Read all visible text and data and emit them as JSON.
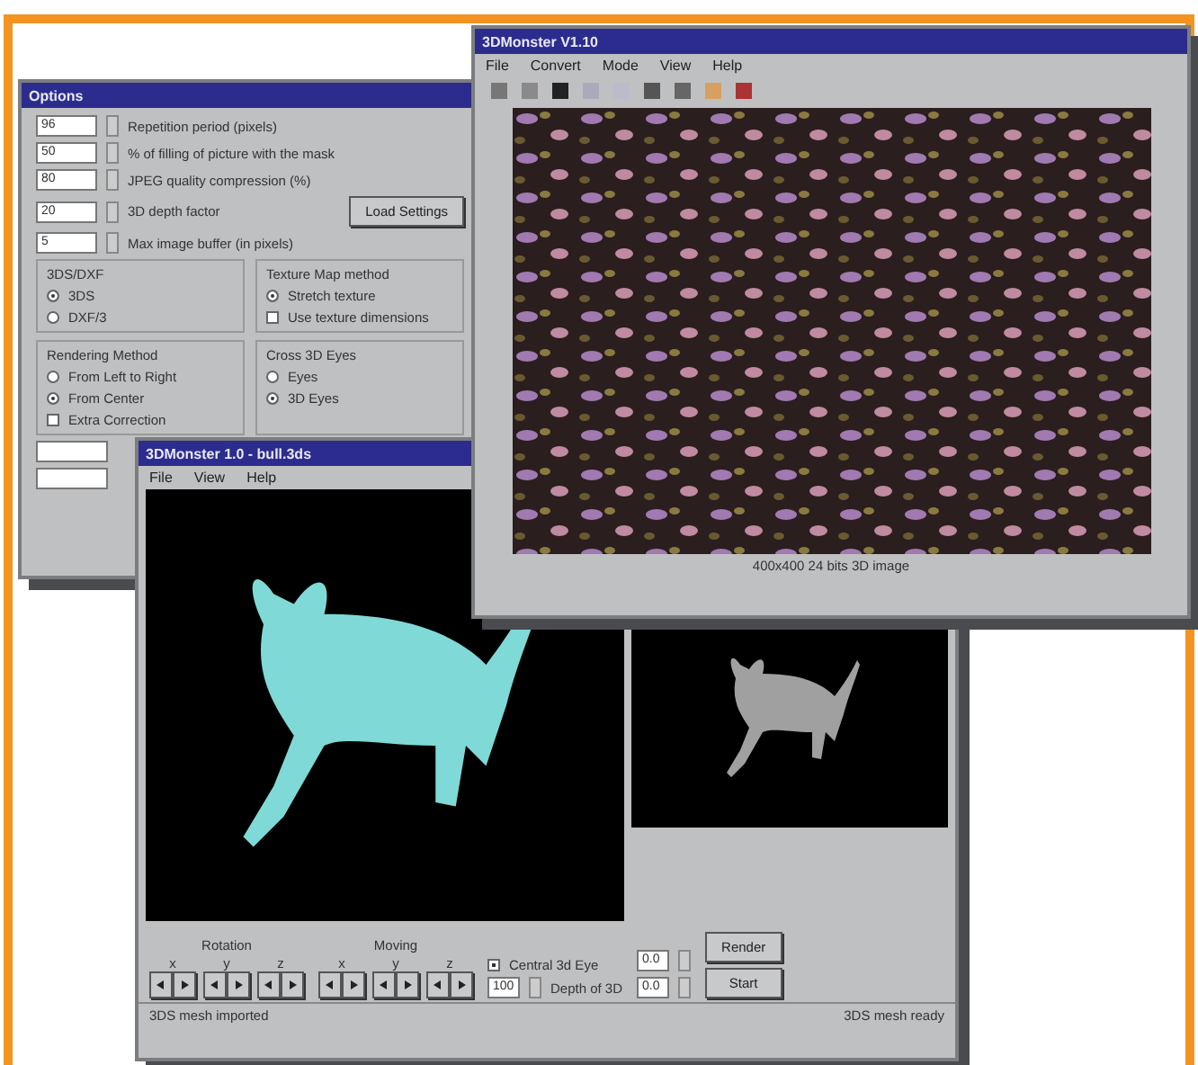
{
  "options_window": {
    "title": "Options",
    "spinners": [
      {
        "value": "96",
        "label": "Repetition period (pixels)"
      },
      {
        "value": "50",
        "label": "% of filling of picture with the mask"
      },
      {
        "value": "80",
        "label": "JPEG quality compression (%)"
      },
      {
        "value": "20",
        "label": "3D depth factor"
      },
      {
        "value": "5",
        "label": "Max image buffer (in pixels)"
      }
    ],
    "load_button": "Load Settings",
    "groups": [
      {
        "title": "3DS/DXF",
        "items": [
          {
            "kind": "radio",
            "label": "3DS",
            "selected": true
          },
          {
            "kind": "radio",
            "label": "DXF/3",
            "selected": false
          }
        ]
      },
      {
        "title": "Texture Map method",
        "items": [
          {
            "kind": "radio",
            "label": "Stretch texture",
            "selected": true
          },
          {
            "kind": "check",
            "label": "Use texture dimensions",
            "selected": false
          }
        ]
      },
      {
        "title": "Rendering Method",
        "items": [
          {
            "kind": "radio",
            "label": "From Left to Right",
            "selected": false
          },
          {
            "kind": "radio",
            "label": "From Center",
            "selected": true
          },
          {
            "kind": "check",
            "label": "Extra Correction",
            "selected": false
          }
        ]
      },
      {
        "title": "Cross 3D Eyes",
        "items": [
          {
            "kind": "radio",
            "label": "Eyes",
            "selected": false
          },
          {
            "kind": "radio",
            "label": "3D Eyes",
            "selected": true
          }
        ]
      }
    ]
  },
  "stereo_window": {
    "title": "3DMonster V1.10",
    "menu": [
      "File",
      "Convert",
      "Mode",
      "View",
      "Help"
    ],
    "status": "400x400 24 bits 3D image"
  },
  "model_window": {
    "title": "3DMonster 1.0 - bull.3ds",
    "menu": [
      "File",
      "View",
      "Help"
    ],
    "rotation_label": "Rotation",
    "moving_label": "Moving",
    "rotation_axes": [
      "x",
      "y",
      "z"
    ],
    "moving_axes": [
      "x",
      "y",
      "z"
    ],
    "center_check": {
      "label": "Central 3d Eye",
      "checked": true
    },
    "spin_value": "100",
    "depth_label": "Depth of 3D",
    "inputs": [
      "0.0",
      "0.0"
    ],
    "buttons": [
      "Render",
      "Start"
    ],
    "status": [
      "3DS mesh imported",
      "3DS mesh ready"
    ]
  }
}
